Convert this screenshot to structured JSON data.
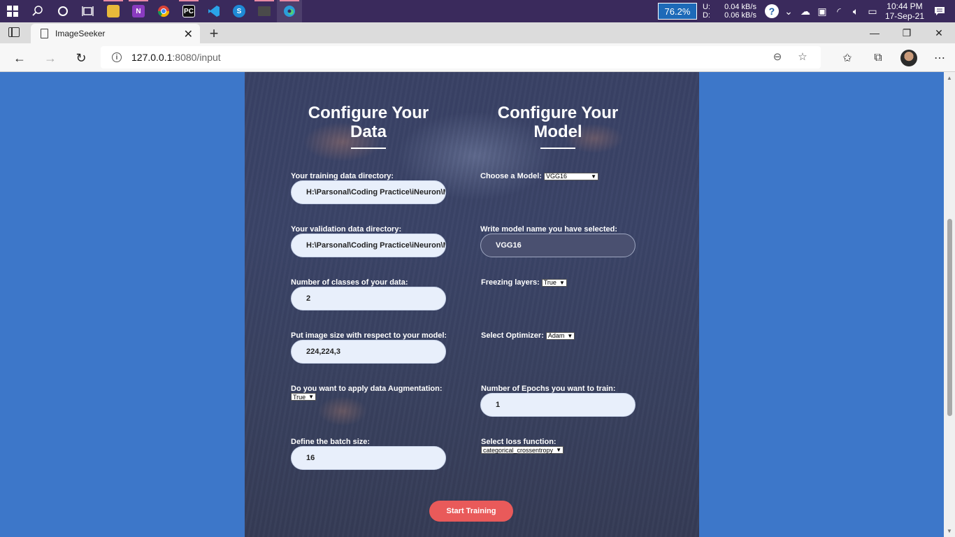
{
  "taskbar": {
    "icons": [
      "windows-start-icon",
      "search-icon",
      "cortana-icon",
      "task-view-icon",
      "file-explorer-icon",
      "onenote-icon",
      "chrome-icon",
      "pycharm-icon",
      "vscode-icon",
      "skype-icon",
      "terminal-icon",
      "edge-icon"
    ],
    "battery": "76.2%",
    "net_up_label": "U:",
    "net_down_label": "D:",
    "net_up": "0.04 kB/s",
    "net_down": "0.06 kB/s",
    "time": "10:44 PM",
    "date": "17-Sep-21"
  },
  "browser": {
    "tab_title": "ImageSeeker",
    "url_host": "127.0.0.1",
    "url_path": ":8080/input"
  },
  "page": {
    "data_title": "Configure Your Data",
    "model_title": "Configure Your Model",
    "left": {
      "train_dir_label": "Your training data directory:",
      "train_dir_value": "H:\\Parsonal\\Coding Practice\\iNeuron\\Moduler Coding\\",
      "val_dir_label": "Your validation data directory:",
      "val_dir_value": "H:\\Parsonal\\Coding Practice\\iNeuron\\Moduler Coding\\",
      "classes_label": "Number of classes of your data:",
      "classes_value": "2",
      "image_size_label": "Put image size with respect to your model:",
      "image_size_value": "224,224,3",
      "augment_label": "Do you want to apply data Augmentation:",
      "augment_value": "True",
      "batch_label": "Define the batch size:",
      "batch_value": "16"
    },
    "right": {
      "model_label": "Choose a Model:",
      "model_value": "VGG16",
      "model_name_label": "Write model name you have selected:",
      "model_name_value": "VGG16",
      "freeze_label": "Freezing layers:",
      "freeze_value": "True",
      "optimizer_label": "Select Optimizer:",
      "optimizer_value": "Adam",
      "epochs_label": "Number of Epochs you want to train:",
      "epochs_value": "1",
      "loss_label": "Select loss function:",
      "loss_value": "categorical_crossentropy"
    },
    "start_button": "Start Training"
  },
  "colors": {
    "page_bg": "#3d77c9",
    "card_bg": "#3a4266",
    "button": "#e95a5a"
  }
}
